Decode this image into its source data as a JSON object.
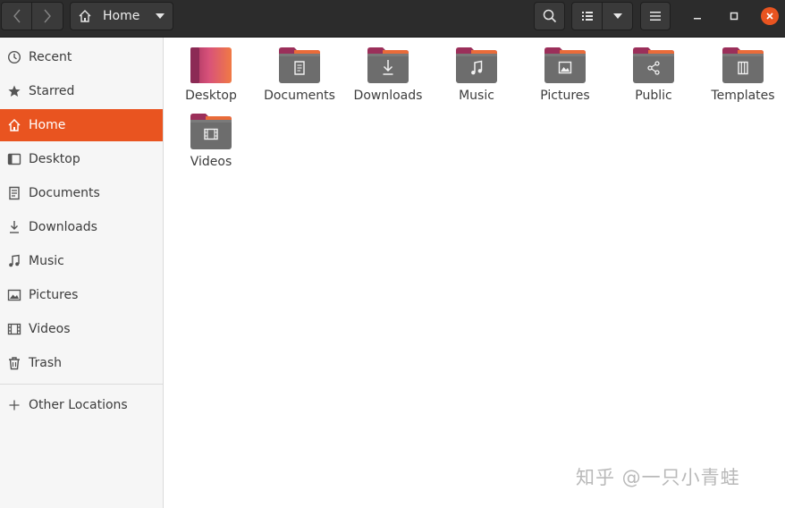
{
  "headerbar": {
    "path_label": "Home",
    "back_icon": "chevron-left-icon",
    "forward_icon": "chevron-right-icon",
    "search_icon": "search-icon",
    "view_icon": "list-view-icon",
    "menu_icon": "hamburger-menu-icon",
    "accent": "#e95420"
  },
  "sidebar": {
    "items": [
      {
        "label": "Recent",
        "icon": "clock-icon"
      },
      {
        "label": "Starred",
        "icon": "star-icon"
      },
      {
        "label": "Home",
        "icon": "home-icon",
        "active": true
      },
      {
        "label": "Desktop",
        "icon": "desktop-icon"
      },
      {
        "label": "Documents",
        "icon": "document-icon"
      },
      {
        "label": "Downloads",
        "icon": "download-icon"
      },
      {
        "label": "Music",
        "icon": "music-icon"
      },
      {
        "label": "Pictures",
        "icon": "picture-icon"
      },
      {
        "label": "Videos",
        "icon": "video-icon"
      },
      {
        "label": "Trash",
        "icon": "trash-icon"
      }
    ],
    "other_locations": {
      "label": "Other Locations",
      "icon": "plus-icon"
    }
  },
  "content": {
    "folders": [
      {
        "label": "Desktop",
        "icon": "desktop-folder-icon"
      },
      {
        "label": "Documents",
        "icon": "documents-folder-icon"
      },
      {
        "label": "Downloads",
        "icon": "downloads-folder-icon"
      },
      {
        "label": "Music",
        "icon": "music-folder-icon"
      },
      {
        "label": "Pictures",
        "icon": "pictures-folder-icon"
      },
      {
        "label": "Public",
        "icon": "public-folder-icon"
      },
      {
        "label": "Templates",
        "icon": "templates-folder-icon"
      },
      {
        "label": "Videos",
        "icon": "videos-folder-icon"
      }
    ]
  },
  "watermark": "知乎 @一只小青蛙"
}
